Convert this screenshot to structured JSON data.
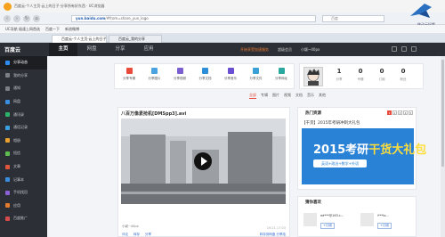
{
  "browser": {
    "title": "百度云·个人主页·云上的日子·分享所有好东西 · UC浏览器",
    "url_host": "yun.baidu.com",
    "url_path": "/#from=share_yun_logo",
    "search_placeholder": "百度",
    "widget_caption": "移动云好看",
    "favorites": [
      "UC导航 极速上网首选",
      "百度一下",
      "新浪微博"
    ],
    "tabs": [
      "百度云·个人主页·云上的日子",
      "百度云_我的分享"
    ]
  },
  "header": {
    "logo": "百度云",
    "nav": [
      "主页",
      "网盘",
      "分享",
      "应用"
    ],
    "promo": "开始享受加速服务",
    "promo_link": "超级会员",
    "user": "小颖~40px"
  },
  "sidebar": {
    "items": [
      {
        "label": "分享动态",
        "color": "#2d8cf0"
      },
      {
        "label": "我的分享",
        "color": "#7a7f88"
      },
      {
        "label": "通知",
        "color": "#7a7f88"
      },
      {
        "label": "网盘",
        "color": "#3b8de0"
      },
      {
        "label": "通讯录",
        "color": "#2db36b"
      },
      {
        "label": "通话记录",
        "color": "#3aa1e0"
      },
      {
        "label": "相册",
        "color": "#e8a02f"
      },
      {
        "label": "短信",
        "color": "#5dbe4f"
      },
      {
        "label": "文章",
        "color": "#e0563b"
      },
      {
        "label": "记事本",
        "color": "#3b8de0"
      },
      {
        "label": "手机找回",
        "color": "#8b62d6"
      },
      {
        "label": "应用",
        "color": "#e37b2f"
      },
      {
        "label": "百度推广",
        "color": "#d64b4b"
      }
    ]
  },
  "tools": [
    {
      "label": "分享专辑",
      "color": "#e84b3c"
    },
    {
      "label": "分享图片",
      "color": "#4aa3e0"
    },
    {
      "label": "分享视频",
      "color": "#7b5fd0"
    },
    {
      "label": "分享文档",
      "color": "#2e8fd8"
    },
    {
      "label": "分享音乐",
      "color": "#6a4fd2"
    },
    {
      "label": "分享文件",
      "color": "#3aa0d8"
    },
    {
      "label": "分享网址",
      "color": "#2aa8a0"
    }
  ],
  "profile": {
    "stats": [
      {
        "n": "1",
        "l": "分享"
      },
      {
        "n": "0",
        "l": "专辑"
      },
      {
        "n": "0",
        "l": "订阅"
      },
      {
        "n": "0",
        "l": "粉丝"
      }
    ]
  },
  "filter_tabs": [
    "全部",
    "专辑",
    "图片",
    "视频",
    "文档",
    "音乐",
    "其他"
  ],
  "post": {
    "title": "八百万像素抢机[DMSpp3].avi",
    "user": "小颖~40px",
    "time": "19:21 17:03",
    "actions": [
      "评论",
      "转存",
      "分享"
    ],
    "actions_right": "转存到网盘 分享给"
  },
  "hot": {
    "title": "热门资源",
    "pages": [
      "1",
      "2",
      "3",
      "4",
      "5"
    ],
    "headline": "【干货】2015年考研冲刺大礼包",
    "banner_main": "2015考研",
    "banner_hl": "干货大礼包",
    "banner_sub": "英语+政治+数学+外语"
  },
  "recommend": {
    "title": "猜你喜欢",
    "items": [
      {
        "name": "ed***@163.c...",
        "btn": "+订阅"
      },
      {
        "name": "i***lo...",
        "btn": "+订阅"
      }
    ]
  }
}
